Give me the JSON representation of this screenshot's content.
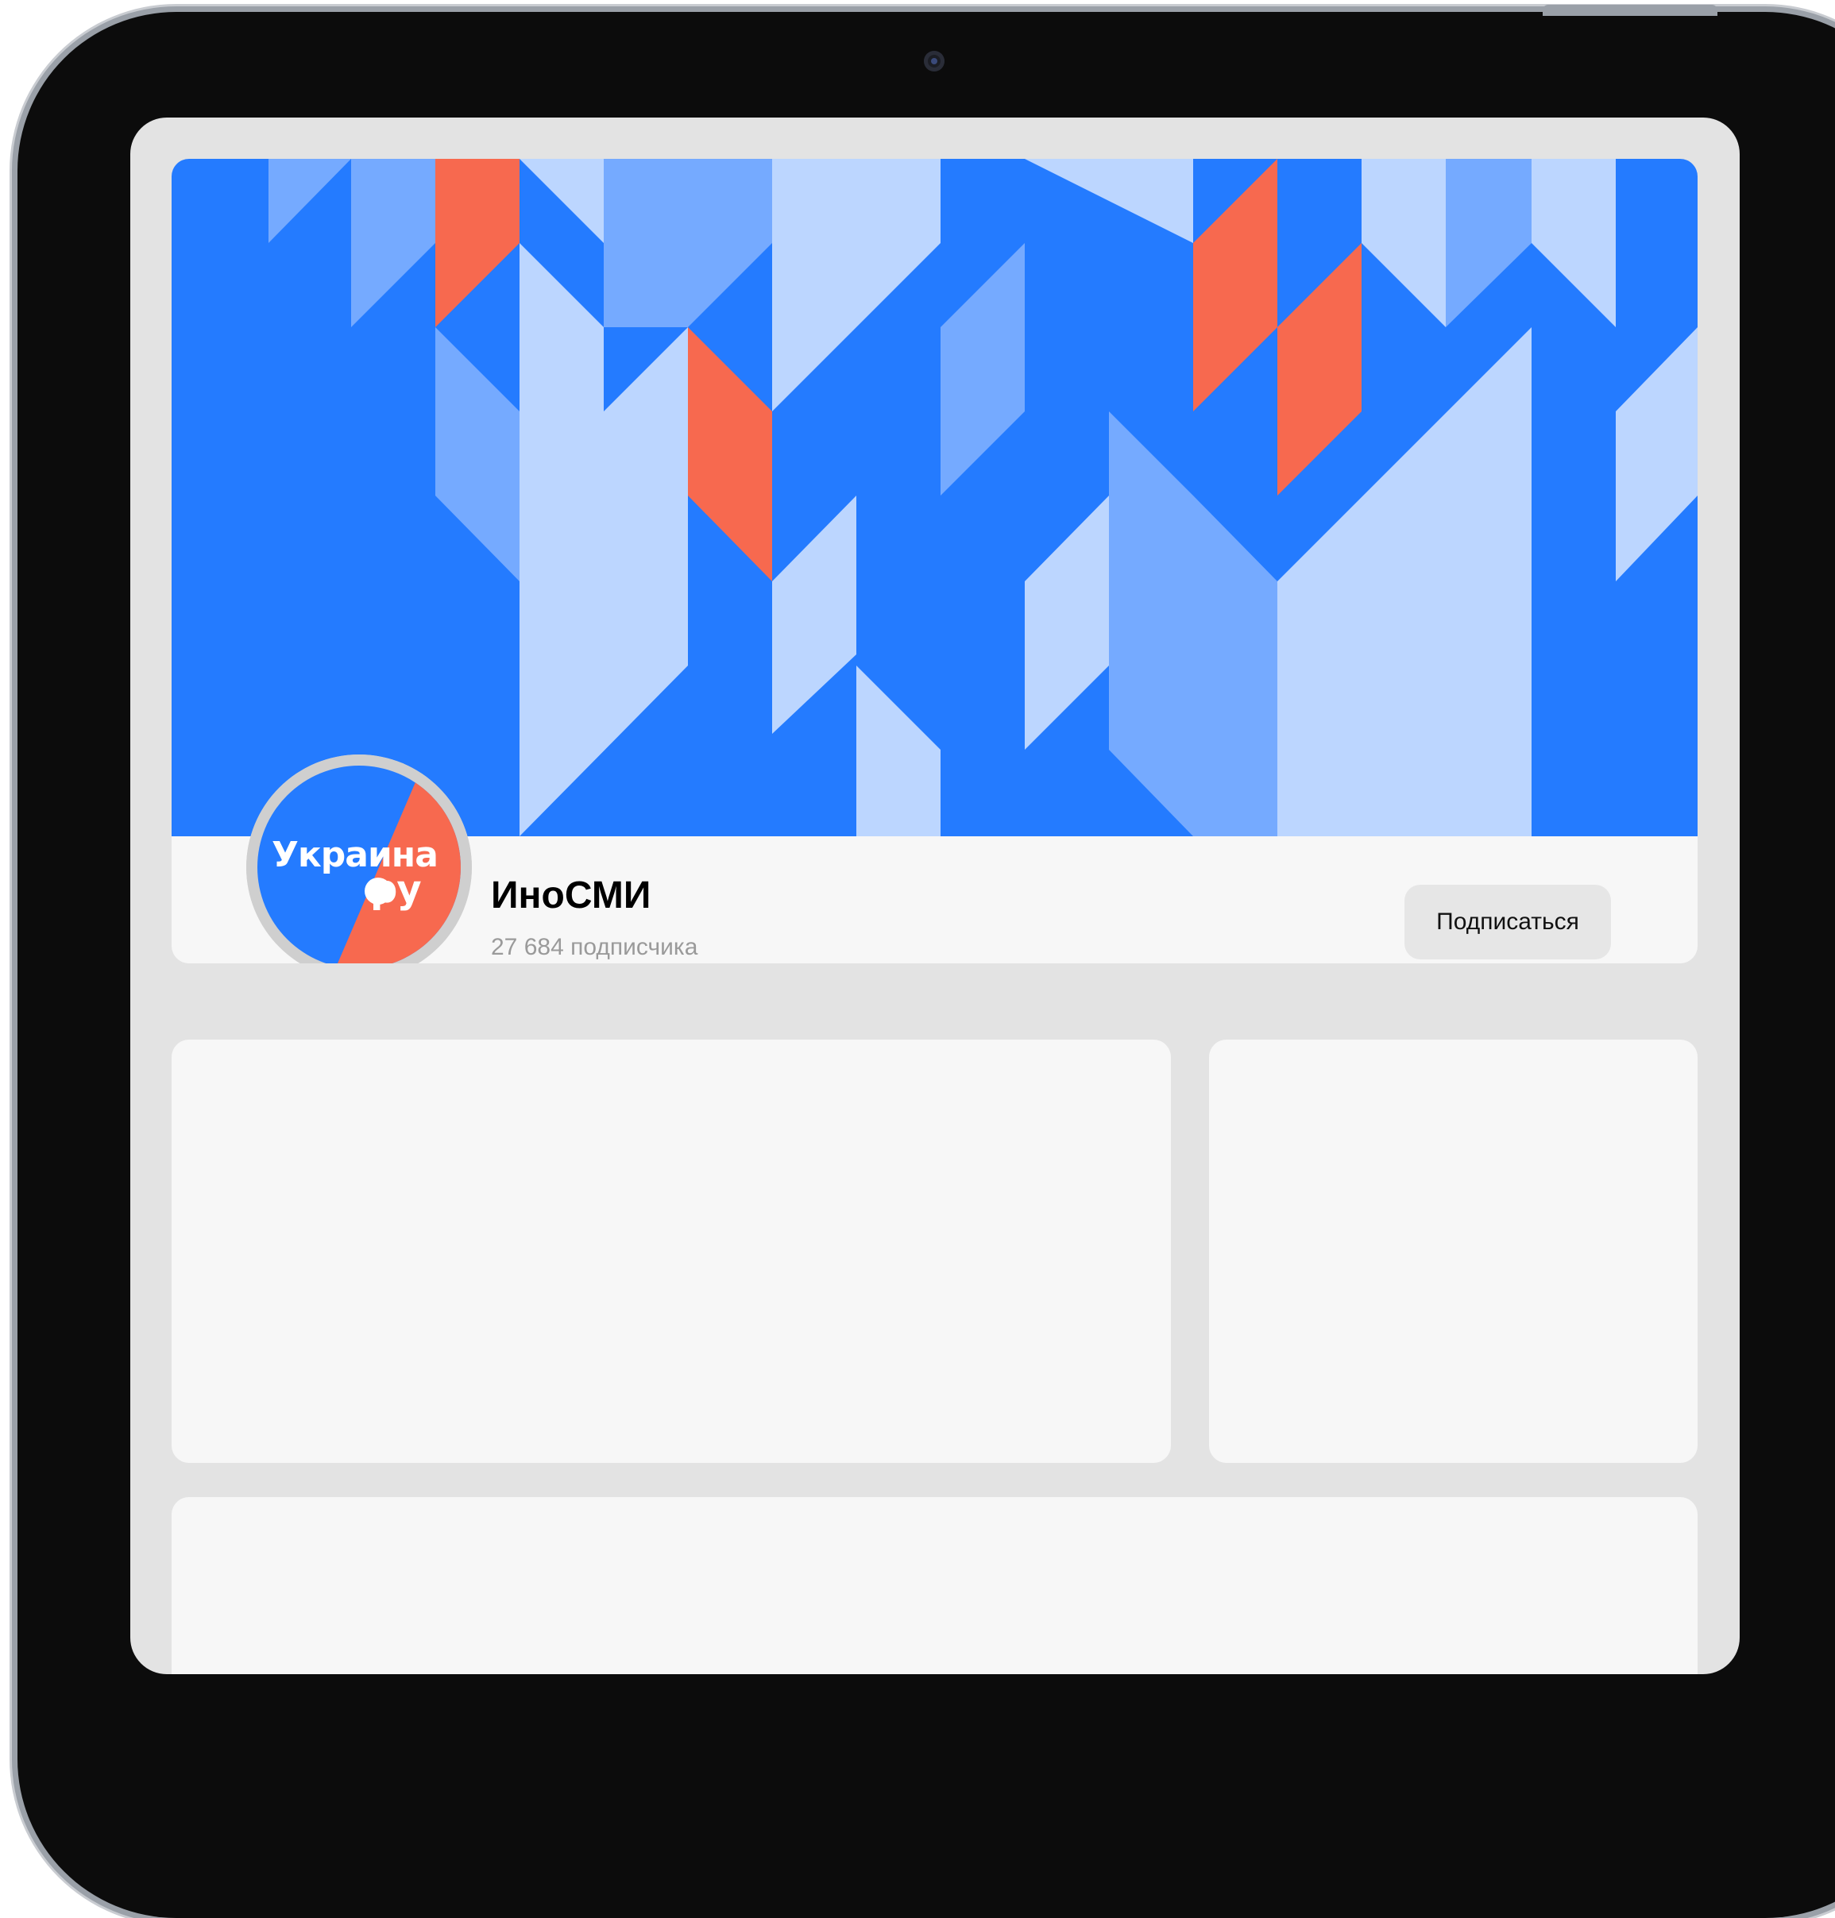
{
  "channel": {
    "name": "ИноСМИ",
    "subscribers": "27 684 подписчика",
    "avatar_logo": {
      "word": "Украина",
      "domain": "ру"
    }
  },
  "actions": {
    "subscribe_label": "Подписаться"
  },
  "banner": {
    "pattern": "geometric-parallelograms",
    "colors": {
      "background": "#247bff",
      "mid_blue": "#75aaff",
      "light_blue": "#bcd6ff",
      "coral": "#f7694f"
    }
  },
  "colors": {
    "screen_background": "#e3e3e3",
    "card_background": "#f7f7f7",
    "button_background": "#e6e6e6",
    "secondary_text": "#9a9a9a",
    "logo_blue": "#247bff",
    "logo_coral": "#f7694f"
  }
}
